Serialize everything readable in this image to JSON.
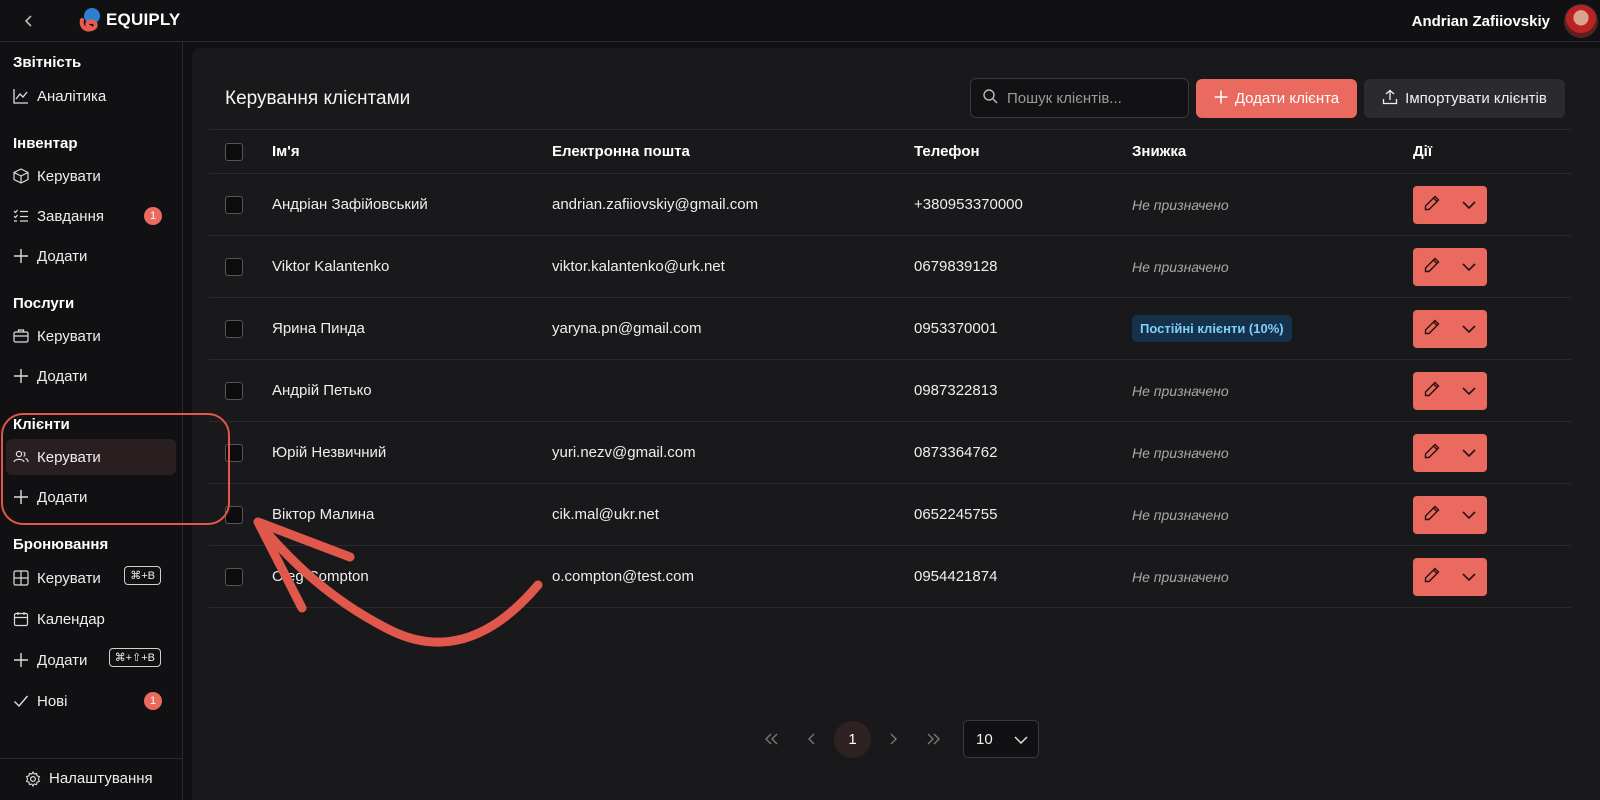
{
  "app": {
    "name": "EQUIPLY"
  },
  "user": {
    "name": "Andrian Zafiiovskiy"
  },
  "sidebar": {
    "sections": [
      {
        "title": "Звітність",
        "items": [
          {
            "label": "Аналітика",
            "icon": "chart-line-icon"
          }
        ]
      },
      {
        "title": "Інвентар",
        "items": [
          {
            "label": "Керувати",
            "icon": "box-icon"
          },
          {
            "label": "Завдання",
            "icon": "list-check-icon",
            "badge": "1"
          },
          {
            "label": "Додати",
            "icon": "plus-icon"
          }
        ]
      },
      {
        "title": "Послуги",
        "items": [
          {
            "label": "Керувати",
            "icon": "briefcase-icon"
          },
          {
            "label": "Додати",
            "icon": "plus-icon"
          }
        ]
      },
      {
        "title": "Клієнти",
        "items": [
          {
            "label": "Керувати",
            "icon": "users-icon",
            "active": true
          },
          {
            "label": "Додати",
            "icon": "plus-icon"
          }
        ]
      },
      {
        "title": "Бронювання",
        "items": [
          {
            "label": "Керувати",
            "icon": "grid-icon",
            "shortcut": "⌘+B"
          },
          {
            "label": "Календар",
            "icon": "calendar-icon"
          },
          {
            "label": "Додати",
            "icon": "plus-icon",
            "shortcut": "⌘+⇧+B"
          },
          {
            "label": "Нові",
            "icon": "check-icon",
            "badge": "1"
          }
        ]
      }
    ],
    "settings_label": "Налаштування"
  },
  "main": {
    "title": "Керування клієнтами",
    "search_placeholder": "Пошук клієнтів...",
    "add_button": "Додати клієнта",
    "import_button": "Імпортувати клієнтів",
    "columns": [
      "Ім'я",
      "Електронна пошта",
      "Телефон",
      "Знижка",
      "Дії"
    ],
    "rows": [
      {
        "name": "Андріан Зафійовський",
        "email": "andrian.zafiiovskiy@gmail.com",
        "phone": "+380953370000",
        "discount": "Не призначено",
        "discount_type": "none"
      },
      {
        "name": "Viktor Kalantenko",
        "email": "viktor.kalantenko@urk.net",
        "phone": "0679839128",
        "discount": "Не призначено",
        "discount_type": "none"
      },
      {
        "name": "Ярина Пинда",
        "email": "yaryna.pn@gmail.com",
        "phone": "0953370001",
        "discount": "Постійні клієнти (10%)",
        "discount_type": "badge"
      },
      {
        "name": "Андрій Петько",
        "email": "",
        "phone": "0987322813",
        "discount": "Не призначено",
        "discount_type": "none"
      },
      {
        "name": "Юрій Незвичний",
        "email": "yuri.nezv@gmail.com",
        "phone": "0873364762",
        "discount": "Не призначено",
        "discount_type": "none"
      },
      {
        "name": "Віктор Малина",
        "email": "cik.mal@ukr.net",
        "phone": "0652245755",
        "discount": "Не призначено",
        "discount_type": "none"
      },
      {
        "name": "Oleg Compton",
        "email": "o.compton@test.com",
        "phone": "0954421874",
        "discount": "Не призначено",
        "discount_type": "none"
      }
    ],
    "pagination": {
      "current_page": "1",
      "page_size": "10"
    }
  },
  "colors": {
    "accent": "#ea6a5f",
    "background": "#111113",
    "panel": "#19191b",
    "badge_blue_text": "#7fd0ff"
  }
}
